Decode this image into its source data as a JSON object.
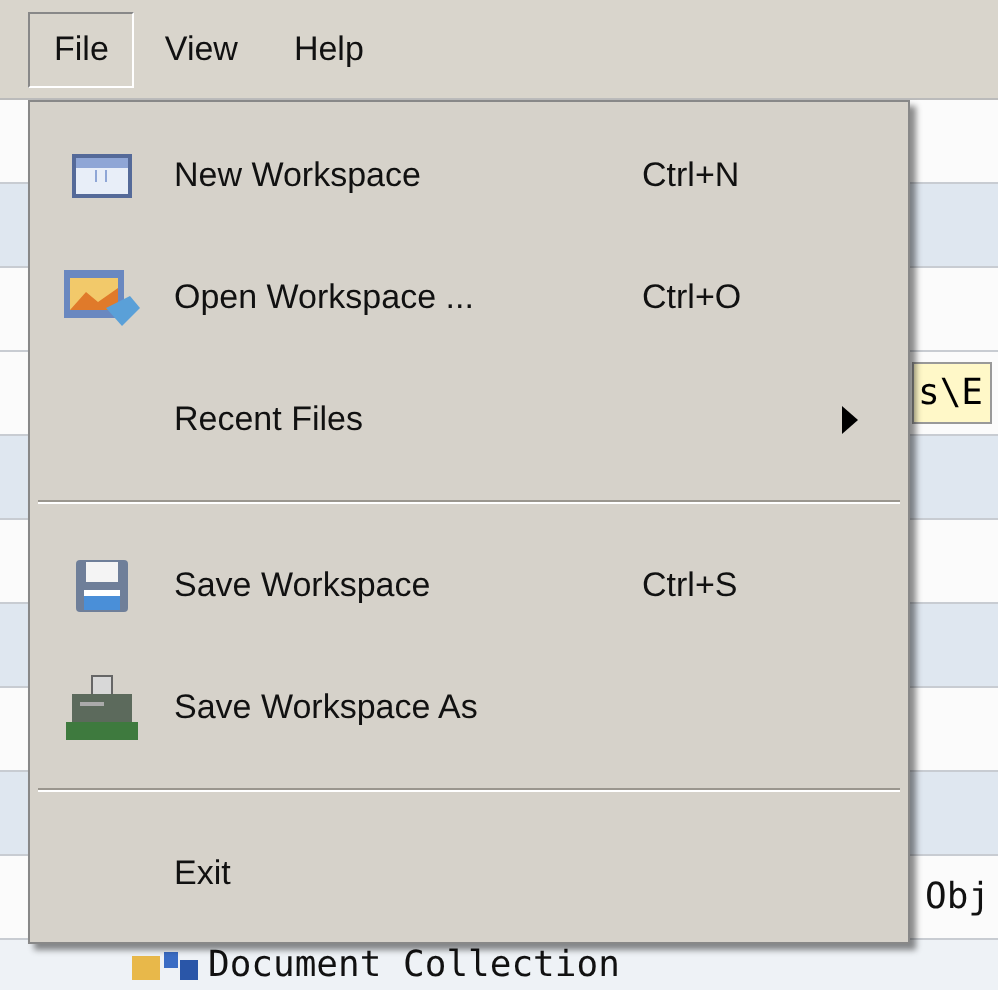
{
  "menubar": [
    {
      "label": "File",
      "selected": true
    },
    {
      "label": "View",
      "selected": false
    },
    {
      "label": "Help",
      "selected": false
    }
  ],
  "file_menu": [
    {
      "kind": "item",
      "label": "New Workspace",
      "shortcut": "Ctrl+N",
      "submenu": false
    },
    {
      "kind": "item",
      "label": "Open Workspace ...",
      "shortcut": "Ctrl+O",
      "submenu": false
    },
    {
      "kind": "item",
      "label": "Recent Files",
      "submenu": true
    },
    {
      "kind": "separator"
    },
    {
      "kind": "item",
      "label": "Save Workspace",
      "shortcut": "Ctrl+S",
      "submenu": false
    },
    {
      "kind": "item",
      "label": "Save Workspace As",
      "submenu": false
    },
    {
      "kind": "separator"
    },
    {
      "kind": "item",
      "label": "Exit",
      "submenu": false
    }
  ],
  "background": {
    "path_field": "s\\E",
    "tree_row": "Obj",
    "tree_item": "Document Collection"
  }
}
